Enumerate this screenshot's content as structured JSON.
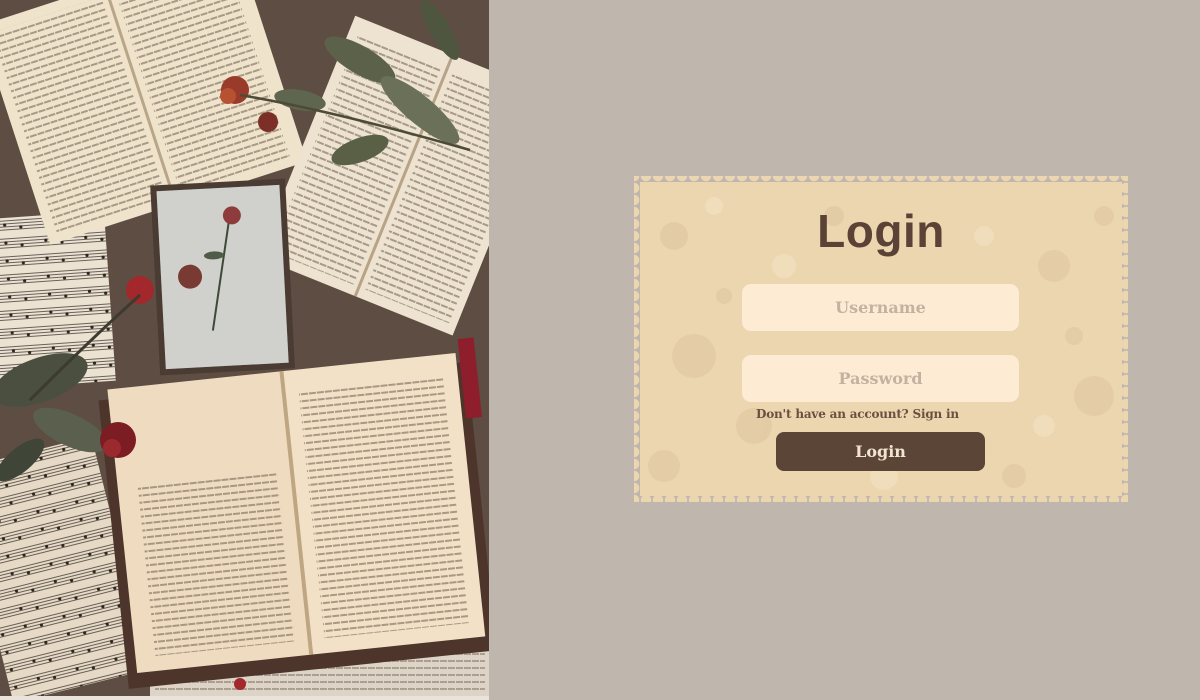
{
  "hero": {
    "image": "open-books-dried-roses-photo"
  },
  "login": {
    "title": "Login",
    "username_placeholder": "Username",
    "password_placeholder": "Password",
    "signup_prompt": "Don't have an account?",
    "signup_link": "Sign in",
    "submit_label": "Login"
  },
  "colors": {
    "page_background": "#bfb6ad",
    "card_background": "#ecd6b0",
    "field_background": "#fdebd3",
    "button_background": "#5b4537",
    "title_color": "#5a4336"
  }
}
